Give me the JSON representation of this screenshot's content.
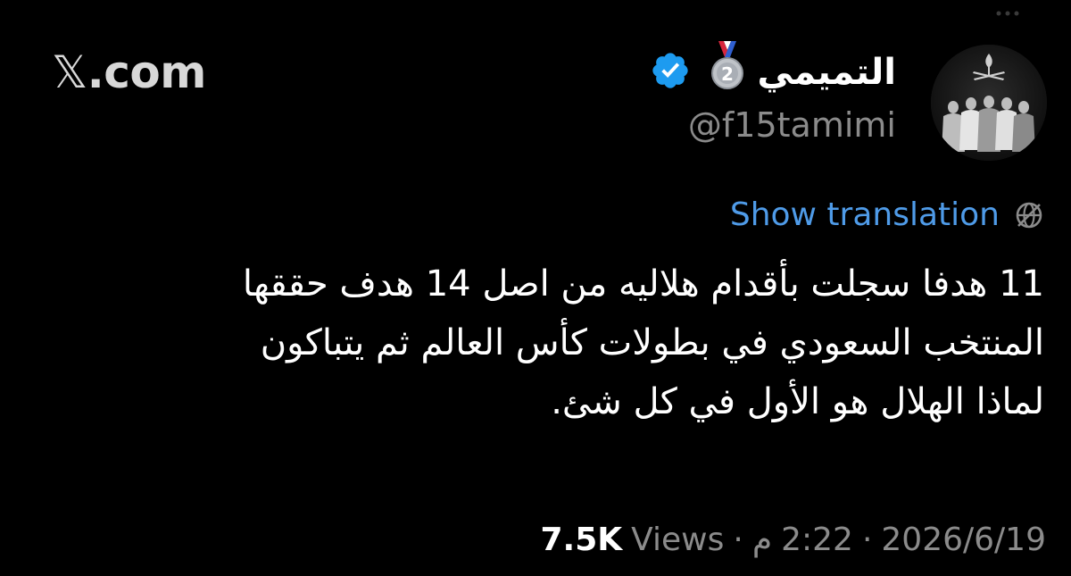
{
  "brand": {
    "label": ".com",
    "mark": "𝕏"
  },
  "author": {
    "display_name": "التميمي",
    "handle": "@f15tamimi",
    "medal_number": "2",
    "verified": true,
    "accent_color": "#4f9be8"
  },
  "tweet": {
    "translate_label": "Show translation",
    "lines": [
      "11 هدفا سجلت بأقدام هلاليه من اصل 14 هدف حققها",
      "المنتخب السعودي في بطولات كأس العالم ثم يتباكون",
      "لماذا الهلال هو الأول في كل شئ."
    ]
  },
  "meta": {
    "date": "2026/6/19",
    "time": "2:22",
    "period": "م",
    "views_count": "7.5K",
    "views_label": "Views",
    "separator": "·"
  },
  "colors": {
    "background": "#000000",
    "text": "#ffffff",
    "muted": "#8b8b8b",
    "link": "#4f9be8",
    "verified": "#1d9bf0"
  },
  "icons": {
    "menu": "more-dots-icon",
    "medal": "medal-icon",
    "verified": "verified-badge-icon",
    "translate": "globe-icon"
  }
}
